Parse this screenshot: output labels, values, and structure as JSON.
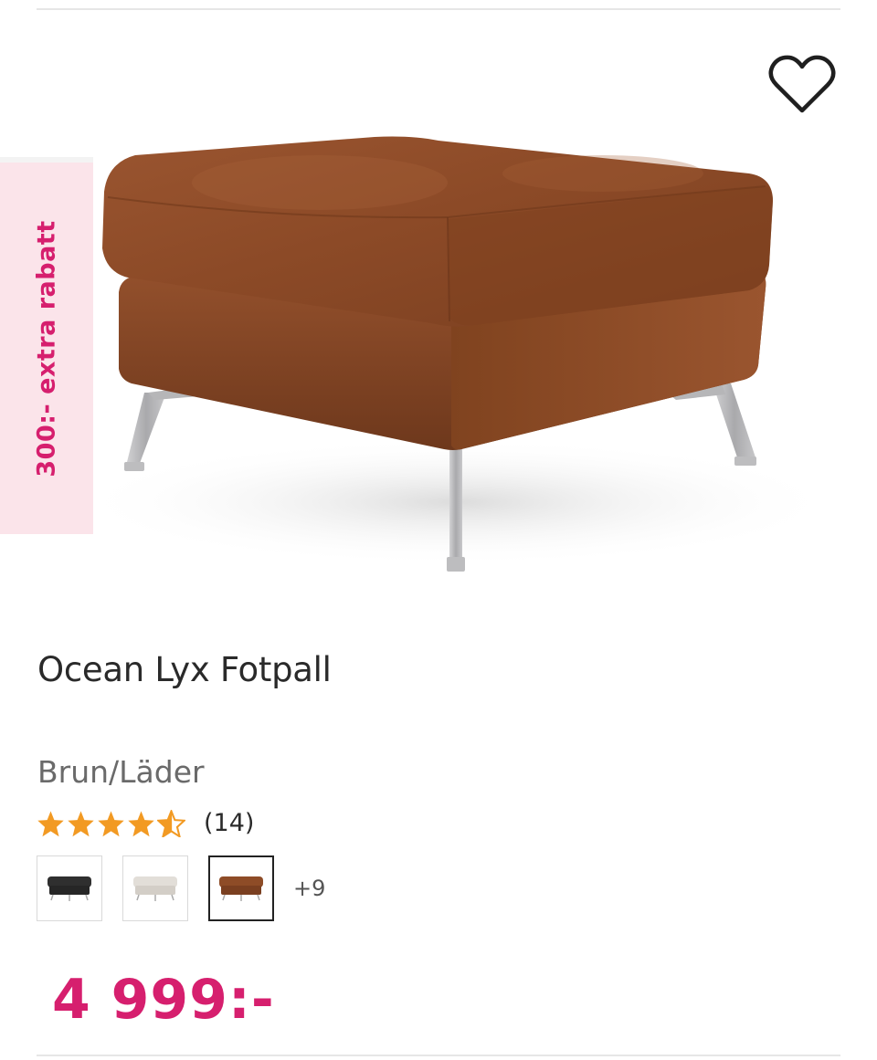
{
  "promo": {
    "badge_text": "300:- extra rabatt"
  },
  "product": {
    "name": "Ocean Lyx Fotpall",
    "variant": "Brun/Läder",
    "rating": 4.5,
    "rating_max": 5,
    "review_count_text": "(14)",
    "price": "4 999:-",
    "main_color": "#8a4a26",
    "leg_color": "#b9b9bc"
  },
  "swatches": {
    "items": [
      {
        "label": "Svart",
        "color": "#2f2f2f",
        "selected": false
      },
      {
        "label": "Beige",
        "color": "#dedad4",
        "selected": false
      },
      {
        "label": "Brun",
        "color": "#8a4a26",
        "selected": true
      }
    ],
    "more_text": "+9"
  },
  "icons": {
    "wishlist": "heart-outline-icon",
    "star": "star-icon"
  },
  "colors": {
    "accent": "#d61f6e",
    "badge_bg": "#fbe4ea",
    "star": "#f29a23"
  }
}
